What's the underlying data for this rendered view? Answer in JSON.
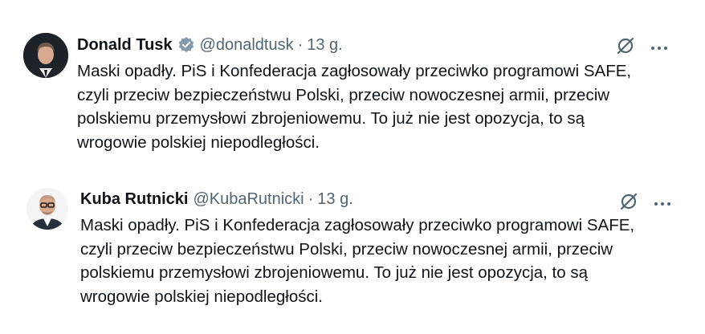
{
  "tweets": [
    {
      "name": "Donald Tusk",
      "handle": "@donaldtusk",
      "separator": "·",
      "time": "13 g.",
      "verified": true,
      "lines": [
        "Maski opadły. PiS i Konfederacja zagłosowały przeciwko programowi SAFE,",
        "czyli przeciw bezpieczeństwu Polski, przeciw nowoczesnej armii, przeciw",
        "polskiemu przemysłowi zbrojeniowemu. To już nie jest opozycja, to są",
        "wrogowie polskiej niepodległości."
      ],
      "icons": [
        "grok-icon",
        "more-icon"
      ]
    },
    {
      "name": "Kuba Rutnicki",
      "handle": "@KubaRutnicki",
      "separator": "·",
      "time": "13 g.",
      "verified": false,
      "lines": [
        "Maski opadły. PiS i Konfederacja zagłosowały przeciwko programowi SAFE,",
        "czyli przeciw bezpieczeństwu Polski, przeciw nowoczesnej armii, przeciw",
        "polskiemu przemysłowi zbrojeniowemu. To już nie jest opozycja, to są",
        "wrogowie polskiej niepodległości."
      ],
      "icons": [
        "grok-icon",
        "more-icon"
      ]
    }
  ],
  "colors": {
    "text": "#0f1419",
    "secondary": "#536471",
    "verified_badge": "#829aab"
  }
}
